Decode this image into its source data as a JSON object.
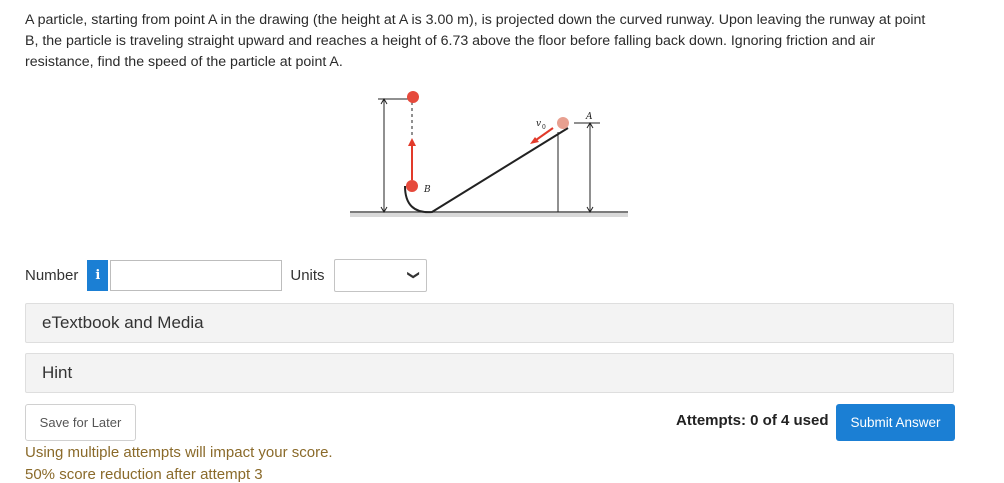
{
  "question": {
    "text": "A particle, starting from point A in the drawing (the height at A is 3.00 m), is projected down the curved runway. Upon leaving the runway at point B, the particle is traveling straight upward and reaches a height of 6.73 above the floor before falling back down. Ignoring friction and air resistance, find the speed of the particle at point A."
  },
  "figure": {
    "label_a": "A",
    "label_b": "B",
    "label_v": "v",
    "label_v_sub": "0"
  },
  "answer": {
    "number_label": "Number",
    "info_icon": "i",
    "number_value": "",
    "units_label": "Units",
    "units_selected": ""
  },
  "panels": {
    "etextbook": "eTextbook and Media",
    "hint": "Hint"
  },
  "footer": {
    "save_label": "Save for Later",
    "attempts": "Attempts: 0 of 4 used",
    "submit_label": "Submit Answer",
    "warning_1": "Using multiple attempts will impact your score.",
    "warning_2": "50% score reduction after attempt 3"
  },
  "colors": {
    "accent": "#1b7fd4",
    "warning_text": "#8a6a2a",
    "ball": "#e64a3c",
    "arrow": "#e23a2a"
  }
}
